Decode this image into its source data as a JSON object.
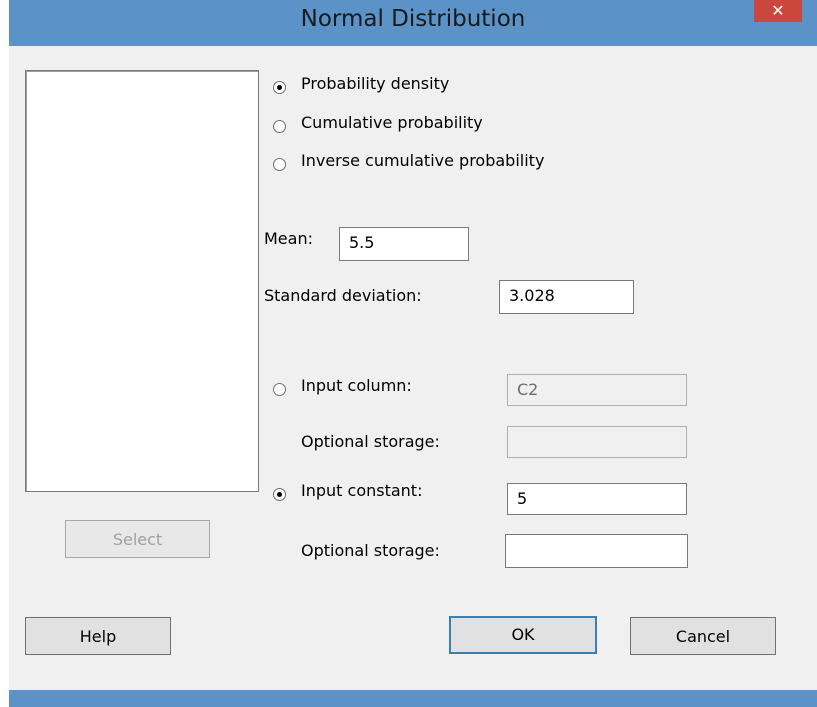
{
  "window": {
    "title": "Normal Distribution",
    "close_glyph": "✕"
  },
  "options": {
    "probability_density": {
      "label": "Probability density",
      "selected": true
    },
    "cumulative": {
      "label": "Cumulative probability",
      "selected": false
    },
    "inverse": {
      "label": "Inverse cumulative probability",
      "selected": false
    }
  },
  "params": {
    "mean_label": "Mean:",
    "mean_value": "5.5",
    "sd_label": "Standard deviation:",
    "sd_value": "3.028"
  },
  "input": {
    "column_label": "Input column:",
    "column_value": "C2",
    "column_selected": false,
    "storage1_label": "Optional storage:",
    "storage1_value": "",
    "constant_label": "Input constant:",
    "constant_value": "5",
    "constant_selected": true,
    "storage2_label": "Optional storage:",
    "storage2_value": ""
  },
  "buttons": {
    "select": "Select",
    "help": "Help",
    "ok": "OK",
    "cancel": "Cancel"
  },
  "colors": {
    "titlebar": "#5b93c9",
    "close": "#c9473d",
    "client": "#f0f0f0"
  }
}
